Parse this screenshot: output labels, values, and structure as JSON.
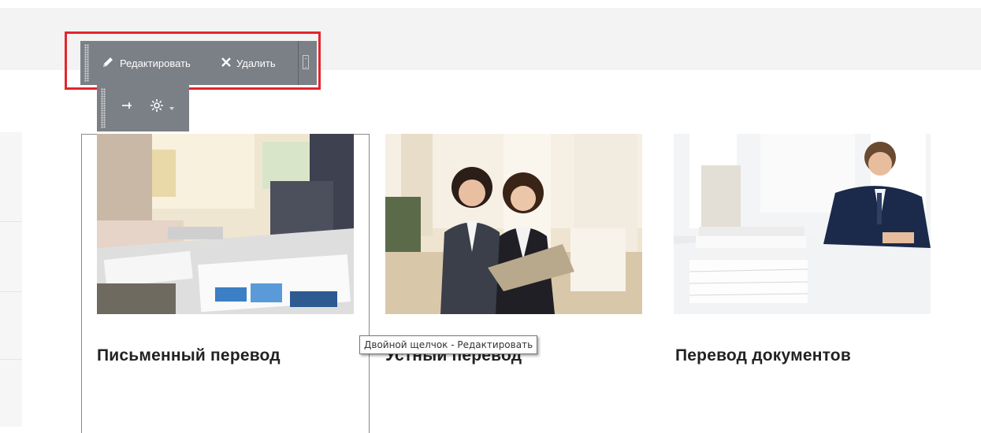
{
  "toolbar": {
    "edit_label": "Редактировать",
    "delete_label": "Удалить"
  },
  "subtoolbar": {
    "pin_icon": "pin-icon",
    "settings_icon": "gear-icon"
  },
  "cards": [
    {
      "title": "Письменный перевод",
      "image": "business-meeting-documents-photo"
    },
    {
      "title": "Устный перевод",
      "image": "two-women-with-laptop-photo"
    },
    {
      "title": "Перевод документов",
      "image": "man-with-paper-stacks-photo"
    }
  ],
  "tooltip": {
    "text": "Двойной щелчок - Редактировать"
  },
  "colors": {
    "panel": "#7b7f86",
    "highlight": "#e3262d"
  }
}
